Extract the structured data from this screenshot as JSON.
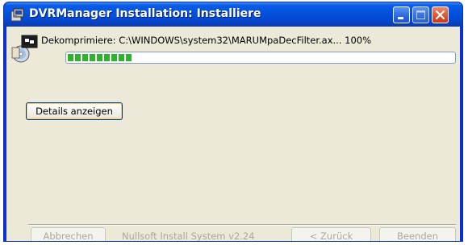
{
  "window": {
    "title": "DVRManager Installation: Installiere",
    "icons": {
      "app": "installer-icon",
      "minimize": "minimize-icon",
      "maximize": "maximize-icon",
      "close": "close-icon"
    },
    "colors": {
      "titlebar": "#0453e0",
      "client": "#ece9d8",
      "close": "#e0532e"
    }
  },
  "main": {
    "status_text": "Dekomprimiere: C:\\WINDOWS\\system32\\MARUMpaDecFilter.ax... 100%",
    "setup_icon": "setup-disk-icon",
    "progress": {
      "value": 0.17,
      "color": "#2fb32f"
    },
    "details_button": "Details anzeigen"
  },
  "footer": {
    "cancel_label": "Abbrechen",
    "branding": "Nullsoft Install System v2.24",
    "back_label": "< Zurück",
    "finish_label": "Beenden"
  }
}
